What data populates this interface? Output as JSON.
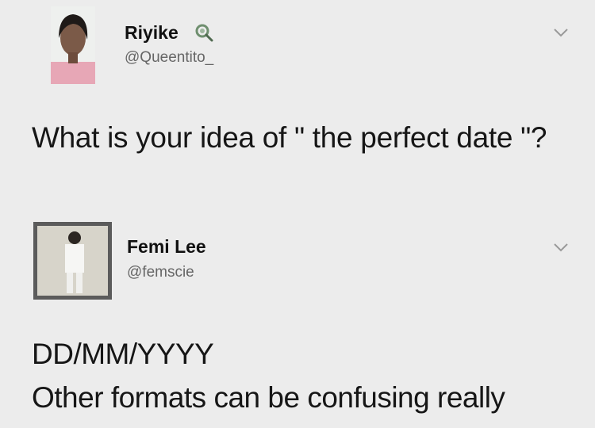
{
  "tweets": [
    {
      "name": "Riyike",
      "handle": "@Queentito_",
      "text": "What is your idea of \" the perfect date \"?",
      "has_emoji_badge": true
    },
    {
      "name": "Femi Lee",
      "handle": "@femscie",
      "text_line1": "DD/MM/YYYY",
      "text_line2": "Other formats can be confusing really"
    }
  ],
  "icons": {
    "badge": "magnifier-emoji-icon",
    "more": "chevron-down-icon"
  },
  "colors": {
    "background": "#ececec",
    "text": "#161616",
    "handle": "#666666"
  }
}
